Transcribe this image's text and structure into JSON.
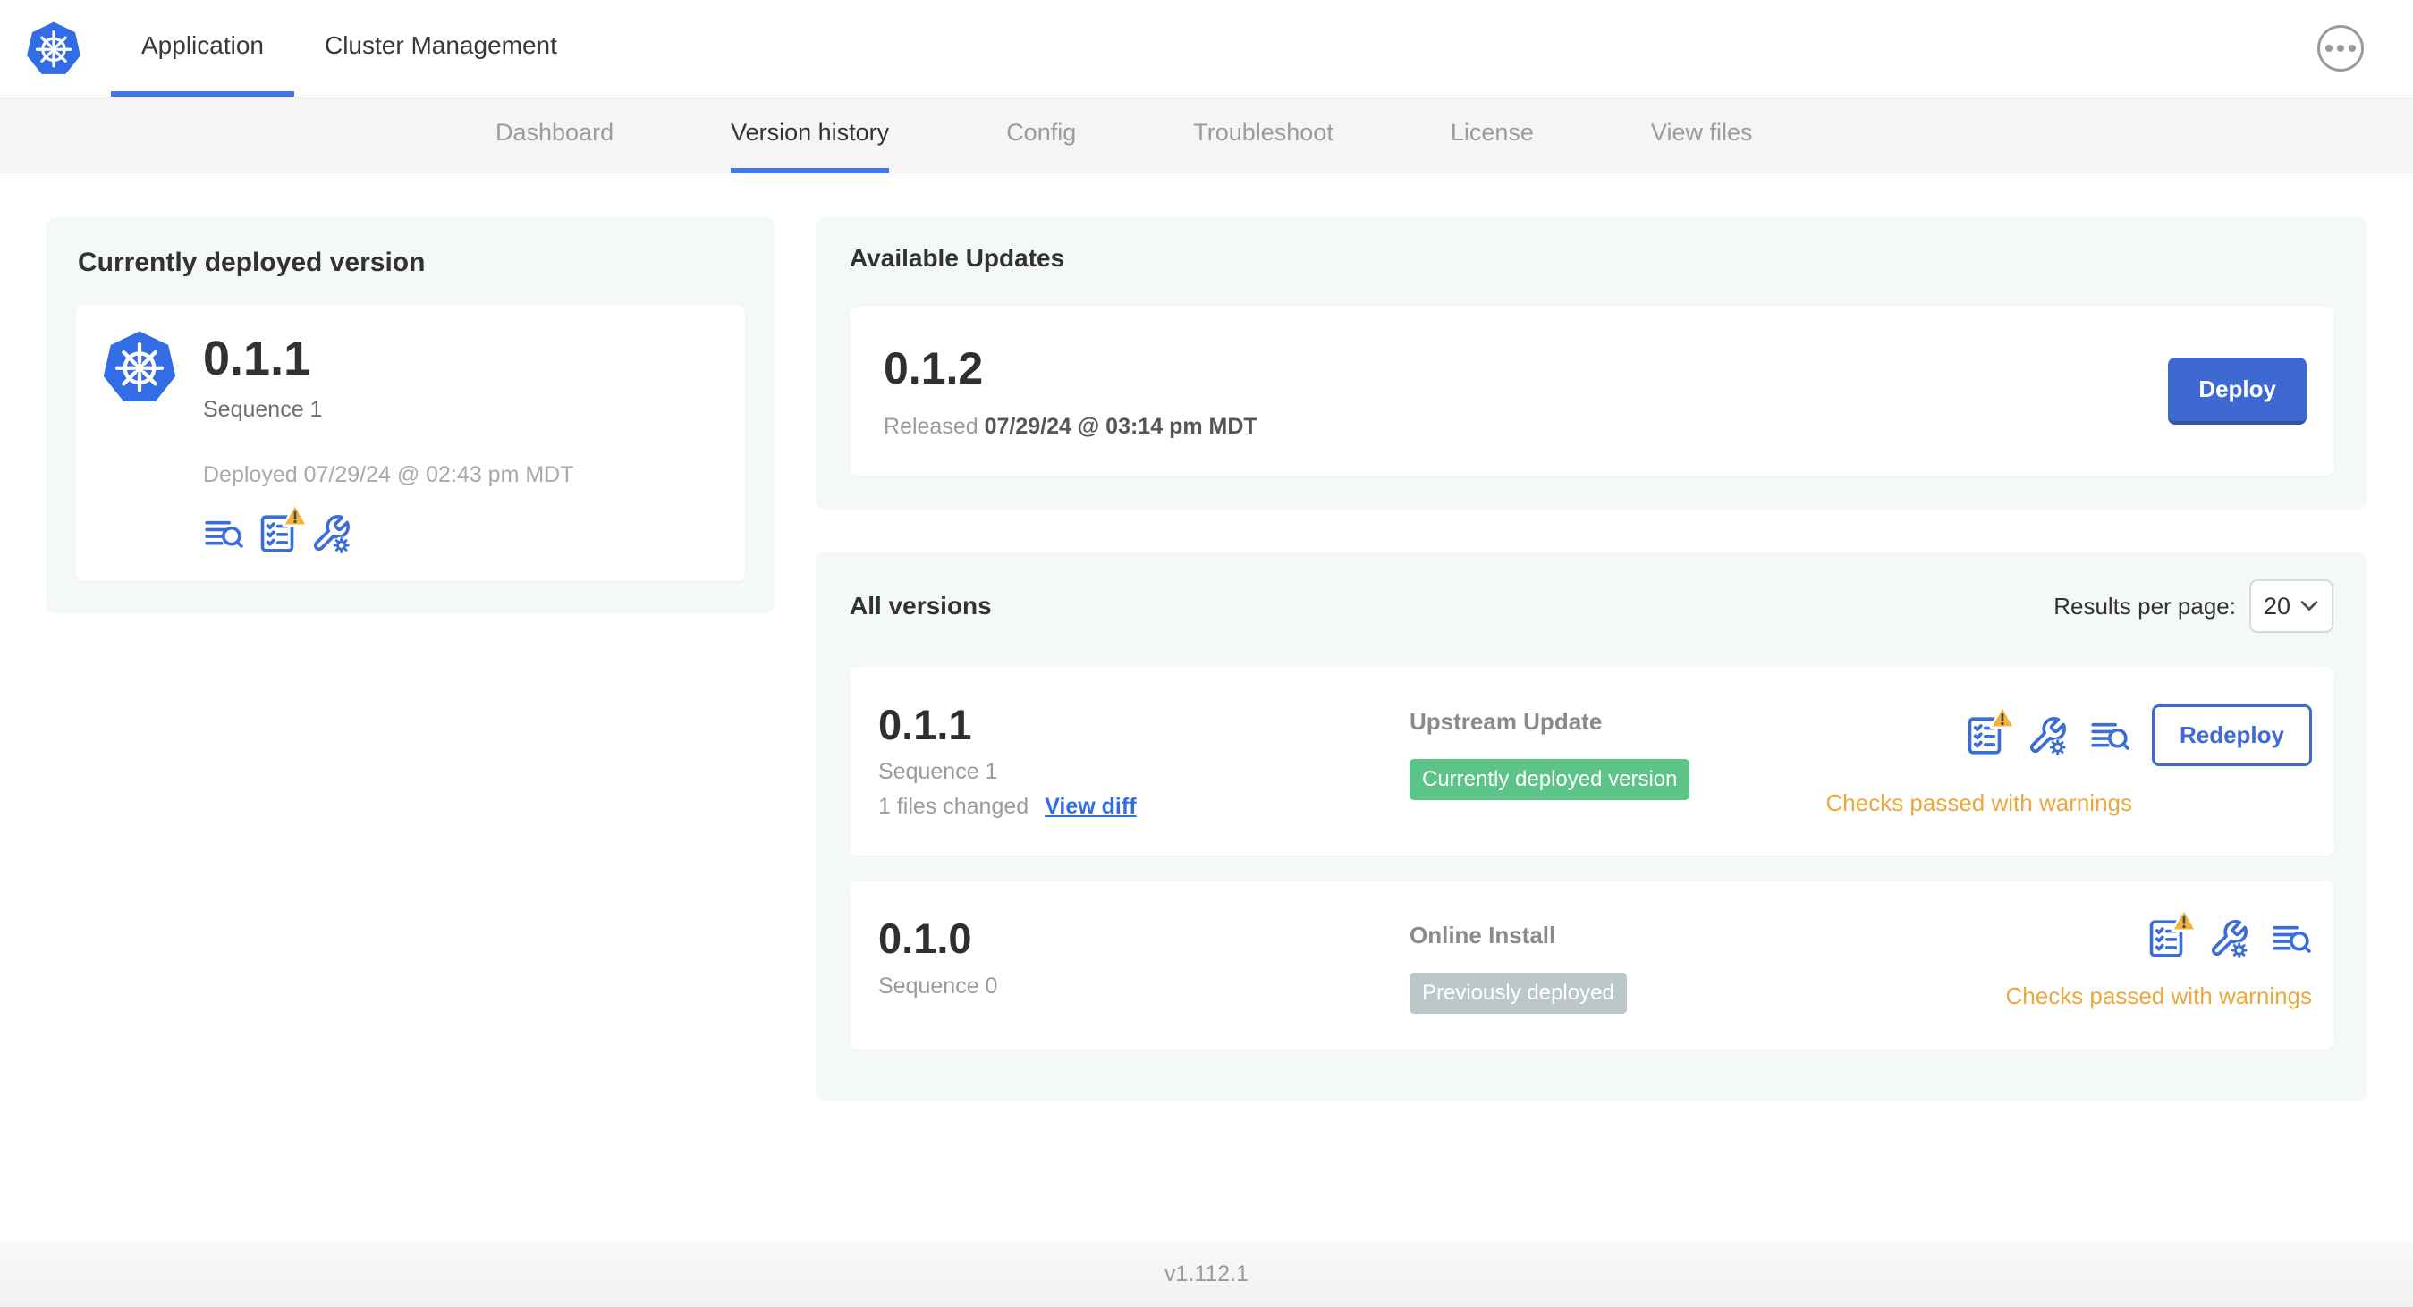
{
  "colors": {
    "primary_blue": "#3e68d2",
    "link_blue": "#326de6",
    "kubernetes_blue": "#326de6",
    "active_tab_underline": "#4276e0",
    "green_badge": "#5cc487",
    "gray_badge": "#bcc7c9",
    "warning_text": "#eda73c",
    "warning_triangle": "#f3b33d"
  },
  "header": {
    "tabs": [
      {
        "label": "Application"
      },
      {
        "label": "Cluster Management"
      }
    ]
  },
  "subnav": {
    "tabs": [
      {
        "label": "Dashboard"
      },
      {
        "label": "Version history"
      },
      {
        "label": "Config"
      },
      {
        "label": "Troubleshoot"
      },
      {
        "label": "License"
      },
      {
        "label": "View files"
      }
    ]
  },
  "current_version_card": {
    "title": "Currently deployed version",
    "version": "0.1.1",
    "sequence": "Sequence 1",
    "deployed_at": "Deployed 07/29/24 @ 02:43 pm MDT",
    "icons": [
      "deploy-logs-icon",
      "preflight-checks-warning-icon",
      "config-values-icon"
    ]
  },
  "available_updates": {
    "title": "Available Updates",
    "version": "0.1.2",
    "released_label": "Released",
    "released_date": "07/29/24 @ 03:14 pm MDT",
    "deploy_button_label": "Deploy"
  },
  "all_versions": {
    "title": "All versions",
    "results_per_page_label": "Results per page:",
    "results_per_page_value": "20",
    "rows": [
      {
        "version": "0.1.1",
        "sequence": "Sequence 1",
        "files_changed": "1 files changed",
        "view_diff_label": "View diff",
        "source": "Upstream Update",
        "badge_label": "Currently deployed version",
        "badge_color": "#5cc487",
        "status_text": "Checks passed with warnings",
        "action_button_label": "Redeploy",
        "icons": [
          "preflight-checks-warning-icon",
          "config-values-icon",
          "deploy-logs-icon"
        ]
      },
      {
        "version": "0.1.0",
        "sequence": "Sequence 0",
        "source": "Online Install",
        "badge_label": "Previously deployed",
        "badge_color": "#bcc7c9",
        "status_text": "Checks passed with warnings",
        "icons": [
          "preflight-checks-warning-icon",
          "config-values-icon",
          "deploy-logs-icon"
        ]
      }
    ]
  },
  "footer": {
    "app_version": "v1.112.1"
  }
}
